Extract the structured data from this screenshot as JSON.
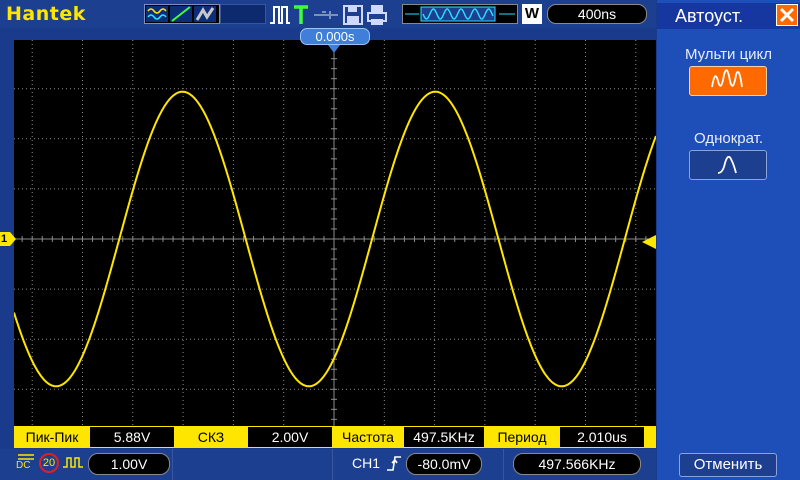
{
  "header": {
    "brand": "Hantek",
    "timebase": "400ns",
    "acq_mode": "W"
  },
  "trigger": {
    "position": "0.000s",
    "channel_label": "CH1",
    "level": "-80.0mV"
  },
  "channel1": {
    "marker": "1",
    "coupling": "DC",
    "bw_limit": "20",
    "volts_per_div": "1.00V"
  },
  "measurements": [
    {
      "label": "Пик-Пик",
      "value": "5.88V"
    },
    {
      "label": "СКЗ",
      "value": "2.00V"
    },
    {
      "label": "Частота",
      "value": "497.5KHz"
    },
    {
      "label": "Период",
      "value": "2.010us"
    }
  ],
  "frequency_counter": "497.566KHz",
  "panel": {
    "title": "Автоуст.",
    "close_icon": "close-icon",
    "multi_cycle_label": "Мульти цикл",
    "single_label": "Однократ.",
    "cancel_label": "Отменить"
  },
  "colors": {
    "trace": "#ffe600",
    "accent_orange": "#ff6a00",
    "grid": "#8c8c8c"
  },
  "waveform": {
    "amplitude_v": 2.94,
    "period_us": 2.01,
    "phase_at_left_deg": 30
  }
}
